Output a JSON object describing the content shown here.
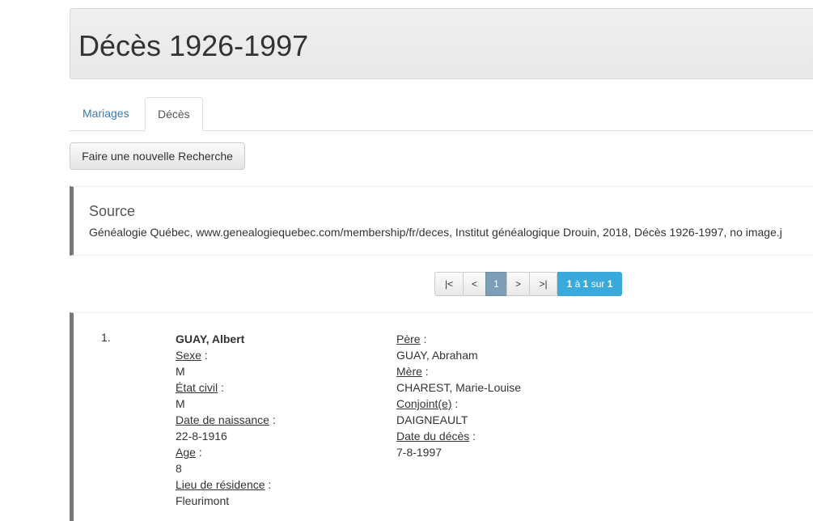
{
  "page": {
    "title": "Décès 1926-1997"
  },
  "tabs": [
    {
      "label": "Mariages"
    },
    {
      "label": "Décès"
    }
  ],
  "toolbar": {
    "new_search_label": "Faire une nouvelle Recherche"
  },
  "source": {
    "heading": "Source",
    "text": "Généalogie Québec, www.genealogiequebec.com/membership/fr/deces, Institut généalogique Drouin, 2018, Décès 1926-1997, no image.j"
  },
  "pagination": {
    "first": "|<",
    "prev": "<",
    "current": "1",
    "next": ">",
    "last": ">|",
    "summary_start": "1",
    "summary_to": "à",
    "summary_end": "1",
    "summary_of": "sur",
    "summary_total": "1"
  },
  "results": [
    {
      "index": "1.",
      "name": "GUAY, Albert",
      "left_fields": [
        {
          "label": "Sexe",
          "value": "M"
        },
        {
          "label": "État civil",
          "value": "M"
        },
        {
          "label": "Date de naissance",
          "value": "22-8-1916"
        },
        {
          "label": "Age",
          "value": "8"
        },
        {
          "label": "Lieu de résidence",
          "value": "Fleurimont"
        }
      ],
      "right_fields": [
        {
          "label": "Père",
          "value": "GUAY, Abraham"
        },
        {
          "label": "Mère",
          "value": "CHAREST, Marie-Louise"
        },
        {
          "label": "Conjoint(e)",
          "value": "DAIGNEAULT"
        },
        {
          "label": "Date du décès",
          "value": "7-8-1997"
        }
      ]
    }
  ]
}
